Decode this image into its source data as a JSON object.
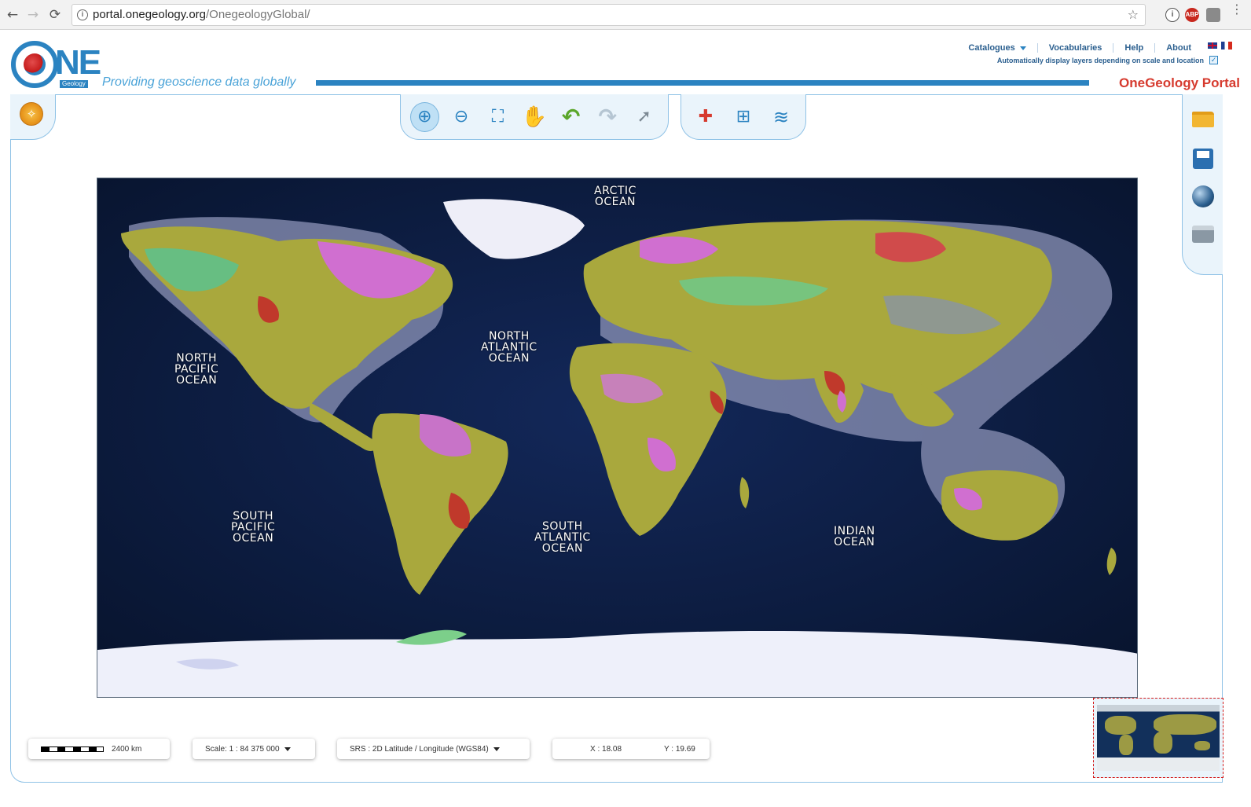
{
  "browser": {
    "back_icon": "←",
    "forward_icon": "→",
    "reload_icon": "⟳",
    "url_host": "portal.onegeology.org",
    "url_path": "/OnegeologyGlobal/",
    "bookmark_icon": "☆",
    "extension_abp": "ABP",
    "extension_info": "i"
  },
  "header": {
    "logo_text": "NE",
    "logo_subtext": "Geology",
    "tagline": "Providing geoscience data globally",
    "portal_title": "OneGeology Portal",
    "menu": {
      "catalogues": "Catalogues",
      "vocabularies": "Vocabularies",
      "help": "Help",
      "about": "About"
    },
    "auto_display_label": "Automatically display layers depending on scale and location",
    "auto_display_checked": true,
    "check_mark": "✓"
  },
  "toolbar": {
    "tools": [
      {
        "name": "zoom-in",
        "glyph": "⊕"
      },
      {
        "name": "zoom-out",
        "glyph": "⊖"
      },
      {
        "name": "zoom-extent",
        "glyph": "⛶"
      },
      {
        "name": "pan",
        "glyph": "✋"
      },
      {
        "name": "undo",
        "glyph": "↶"
      },
      {
        "name": "redo",
        "glyph": "↷"
      },
      {
        "name": "info",
        "glyph": "➚"
      }
    ],
    "layer_tools": [
      {
        "name": "add-onegeology-layer",
        "glyph": "✚"
      },
      {
        "name": "add-wms-layer",
        "glyph": "⊞"
      },
      {
        "name": "layers",
        "glyph": "≋"
      }
    ],
    "compass_glyph": "✧"
  },
  "map": {
    "labels": {
      "arctic": "ARCTIC\nOCEAN",
      "north_pacific": "NORTH\nPACIFIC\nOCEAN",
      "north_atlantic": "NORTH\nATLANTIC\nOCEAN",
      "south_pacific": "SOUTH\nPACIFIC\nOCEAN",
      "south_atlantic": "SOUTH\nATLANTIC\nOCEAN",
      "indian": "INDIAN\nOCEAN"
    },
    "colors": {
      "ocean": "#0c1a3a",
      "land": "#a9a83d",
      "shelf": "#b8bed8",
      "ice": "#eef0fa"
    }
  },
  "status": {
    "scale_distance": "2400 km",
    "scale_label": "Scale: 1 : 84 375 000",
    "srs_label": "SRS : 2D Latitude / Longitude (WGS84)",
    "x_label": "X : 18.08",
    "y_label": "Y : 19.69"
  }
}
